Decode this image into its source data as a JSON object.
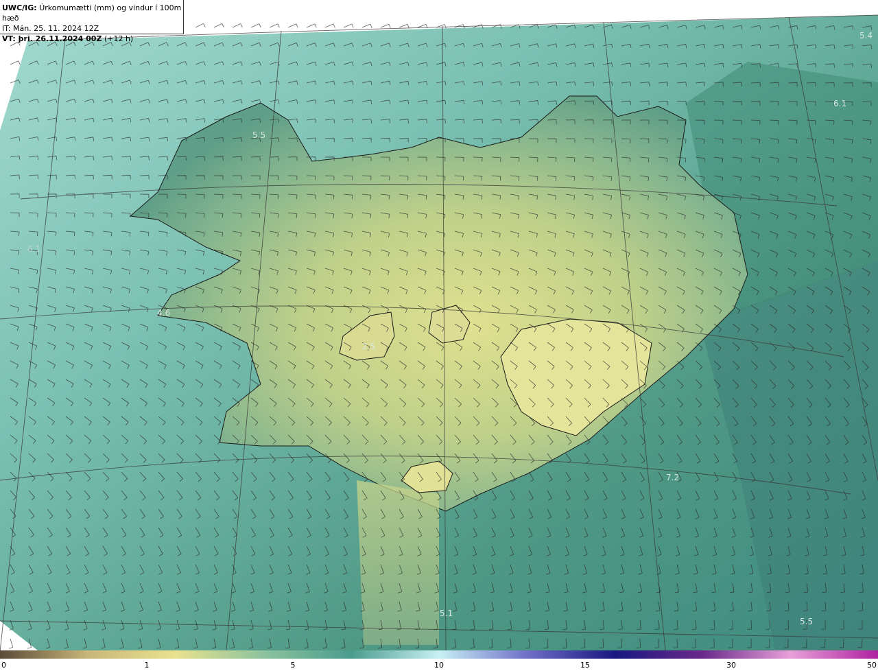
{
  "header": {
    "model": "UWC/IG:",
    "title": "Úrkomumætti (mm) og vindur í 100m hæð",
    "init_time": "IT: Mán. 25. 11. 2024 12Z",
    "valid_label": "VT: þri. 26.11.2024 00Z",
    "valid_offset": "(+12 h)"
  },
  "map_values": [
    {
      "label": "5.4"
    },
    {
      "label": "6.1"
    },
    {
      "label": "5.5"
    },
    {
      "label": "6.1"
    },
    {
      "label": "4.6"
    },
    {
      "label": "2.5"
    },
    {
      "label": "7.2"
    },
    {
      "label": "5.1"
    },
    {
      "label": "5.5"
    }
  ],
  "colorbar": {
    "ticks": [
      "0",
      "1",
      "5",
      "10",
      "15",
      "30",
      "50"
    ],
    "colors": [
      "#5b4a38",
      "#c9b67a",
      "#e9e28e",
      "#8cc39e",
      "#4b9c8d",
      "#c8f0f4",
      "#7070c8",
      "#181880",
      "#6a2a8a",
      "#e8a0d8",
      "#b020a0"
    ]
  },
  "colors": {
    "sea": "#5a9e8e",
    "sea_light": "#9cd4c8",
    "land_high": "#d4d98c",
    "land_mid": "#7ab08a",
    "barb": "#2a2a2a"
  }
}
